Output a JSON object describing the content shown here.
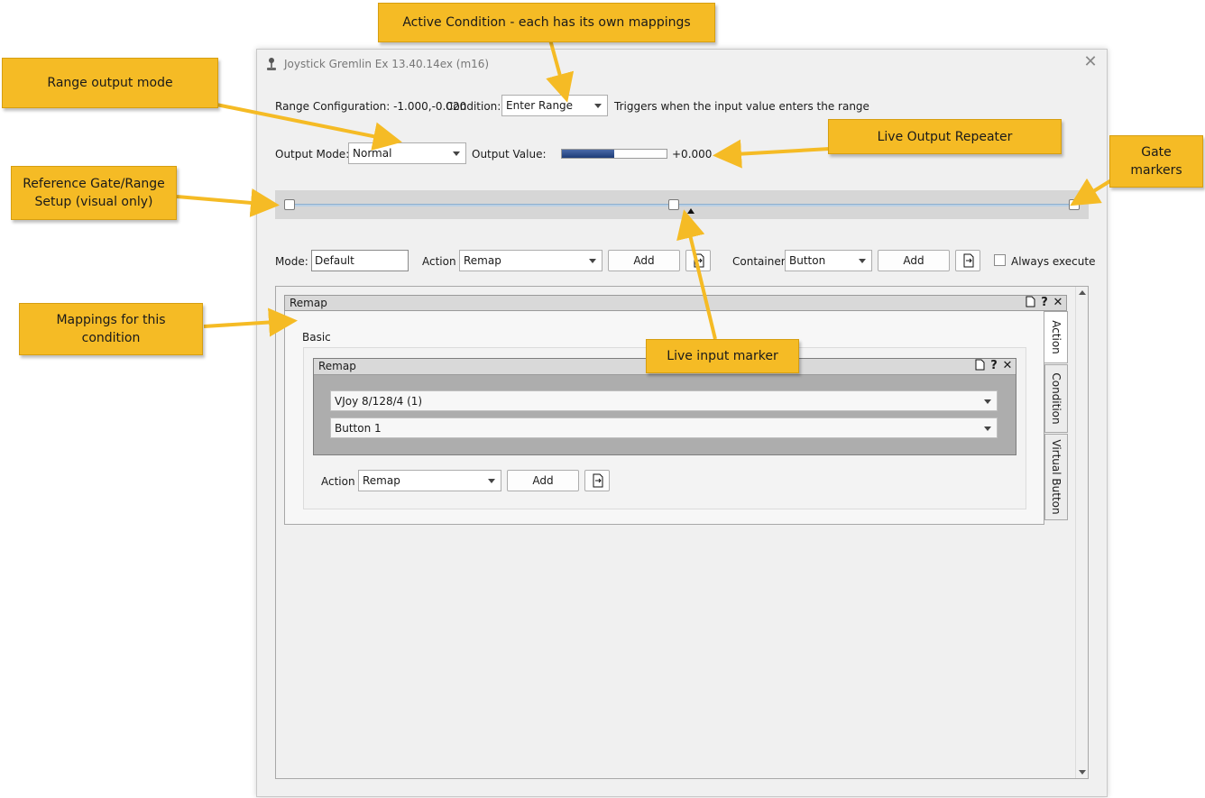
{
  "window": {
    "title": "Joystick Gremlin Ex 13.40.14ex (m16)",
    "close_glyph": "✕"
  },
  "range_row": {
    "range_label": "Range Configuration: -1.000,-0.020",
    "condition_label": "Condition:",
    "condition_value": "Enter Range",
    "condition_description": "Triggers when the input value enters the range"
  },
  "output_row": {
    "mode_label": "Output Mode:",
    "mode_value": "Normal",
    "value_label": "Output Value:",
    "progress_fraction": 0.5,
    "value_text": "+0.000"
  },
  "slider": {
    "handle_values": [
      -1.0,
      -0.02,
      1.0
    ],
    "marker_value": 0.0
  },
  "toolbar": {
    "mode_label": "Mode:",
    "mode_value": "Default",
    "action_label": "Action",
    "action_value": "Remap",
    "add_label": "Add",
    "container_label": "Container",
    "container_value": "Button",
    "container_add_label": "Add",
    "always_execute_label": "Always execute"
  },
  "container": {
    "title": "Remap",
    "header_icons": [
      "page-icon",
      "help-icon",
      "close-icon"
    ],
    "group_label": "Basic",
    "inner": {
      "title": "Remap",
      "device_value": "VJoy 8/128/4 (1)",
      "button_value": "Button 1"
    },
    "action_label": "Action",
    "action_value": "Remap",
    "add_label": "Add",
    "tabs": [
      "Action",
      "Condition",
      "Virtual Button"
    ],
    "active_tab": "Action"
  },
  "callouts": {
    "active_condition": "Active Condition - each has its own mappings",
    "range_output_mode": "Range output mode",
    "live_output_repeater": "Live Output Repeater",
    "gate_markers": "Gate markers",
    "reference_gate": "Reference Gate/Range Setup (visual only)",
    "mappings": "Mappings for this condition",
    "live_input_marker": "Live input marker"
  },
  "colors": {
    "callout_fill": "#f5bb25",
    "callout_arrow": "#f5bb25",
    "progress_fill": "#1e3c78"
  }
}
